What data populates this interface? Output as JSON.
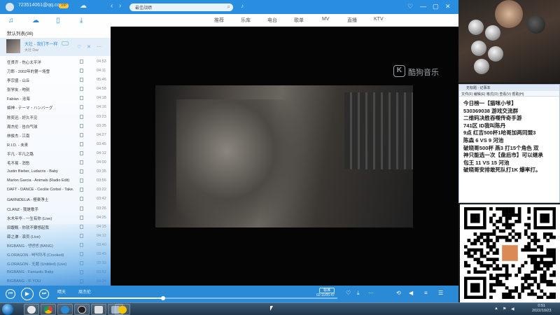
{
  "player": {
    "account": "723514061@qq.com",
    "vip_badge": "VIP",
    "search_query": "最佳战绩",
    "nav": {
      "back": "‹",
      "forward": "›"
    },
    "window_controls": [
      "♡",
      "—",
      "▢",
      "✕"
    ],
    "left_tabs": [
      "music-note-icon",
      "cloud-icon",
      "phone-icon",
      "download-icon"
    ],
    "playlist_header": "默认列表(98)",
    "now_playing": {
      "title": "大壮 - 我们不一样",
      "artist": "大壮 Daz"
    },
    "songs": [
      {
        "name": "任贤齐 - 伤心太平洋",
        "duration": "04:53"
      },
      {
        "name": "刀郎 - 2002年的第一场雪",
        "duration": "04:11"
      },
      {
        "name": "李宗盛 - 山丘",
        "duration": "05:46"
      },
      {
        "name": "张学友 - 吻别",
        "duration": "04:58"
      },
      {
        "name": "Fabian - 沧海",
        "duration": "04:18"
      },
      {
        "name": "姬神 - テーマ・ハンバーグ",
        "duration": "04:16"
      },
      {
        "name": "陈奕迅 - 好久不见",
        "duration": "03:23"
      },
      {
        "name": "周杰伦 - 告白气球",
        "duration": "03:35"
      },
      {
        "name": "林俊杰 - 江南",
        "duration": "04:27"
      },
      {
        "name": "R.I.O. - 未来",
        "duration": "03:45"
      },
      {
        "name": "平凡 - 平凡之路",
        "duration": "04:12"
      },
      {
        "name": "毛不易 - 消愁",
        "duration": "04:00"
      },
      {
        "name": "Justin Bieber, Ludacris - Baby",
        "duration": "03:35"
      },
      {
        "name": "Marlon Garcia - Animals (Radio Edit)",
        "duration": "03:56"
      },
      {
        "name": "DAFT - DANCE - Cecilie Corbel - Take...",
        "duration": "03:22"
      },
      {
        "name": "GARNiDELiA - 極楽浄土",
        "duration": "03:42"
      },
      {
        "name": "CLANZ - 我是歌手",
        "duration": "03:26"
      },
      {
        "name": "水木年华 - 一生有你 (Live)",
        "duration": "04:25"
      },
      {
        "name": "田馥甄 - 你就不要想起我",
        "duration": "04:15"
      },
      {
        "name": "薛之谦 - 演员 (Live)",
        "duration": "04:12"
      },
      {
        "name": "BIGBANG - 뱅뱅뱅 (BANG)",
        "duration": "03:40"
      },
      {
        "name": "G-DRAGON - 삐딱하게 (Crooked)",
        "duration": "03:45"
      },
      {
        "name": "G-DRAGON - 无题 (Untitled) (Live)",
        "duration": "03:33"
      },
      {
        "name": "BIGBANG - Fantastic Baby",
        "duration": "03:52"
      },
      {
        "name": "BIGBANG - IF YOU",
        "duration": "04:24"
      }
    ],
    "category_tabs": [
      "推荐",
      "乐库",
      "电台",
      "歌单",
      "MV",
      "直播",
      "KTV"
    ],
    "logo_text": "酷狗音乐",
    "logo_badge": "K",
    "controls": {
      "song": "晴天",
      "artist": "周杰伦",
      "quality": "标准",
      "time": "02:11/05:47",
      "progress": 0.378,
      "icons": [
        "heart-icon",
        "download-icon",
        "more-icon",
        "loop-icon",
        "volume-icon",
        "lyrics-icon",
        "playlist-icon"
      ]
    }
  },
  "overlay": {
    "notepad_title": "无标题 - 记事本",
    "notepad_menu": "文件(F) 编辑(E) 格式(O) 查看(V) 帮助(H)",
    "lines": [
      "今日榜一【猫咪小爷】",
      "530369038 游戏交流群",
      "二维码决胜吞噬传奇手游",
      "741区 ID我叫陈丹",
      "9点 红吉500杯1哈哥加两同盟3",
      "陈森 6 VS 9 河池",
      "破晓哥500杯 燕3 打15个角色 双",
      "神只能选一次【盘后市】可以继承",
      "包王 11 VS 15 河池",
      "破晓哥安排敢死队打1K 爆率打。"
    ]
  },
  "taskbar": {
    "time": "0:51",
    "date": "2022/10/23",
    "apps": [
      "ie-icon",
      "chrome-icon",
      "kugou-icon",
      "game-icon",
      "explorer-icon",
      "media-icon",
      "app-icon"
    ]
  }
}
